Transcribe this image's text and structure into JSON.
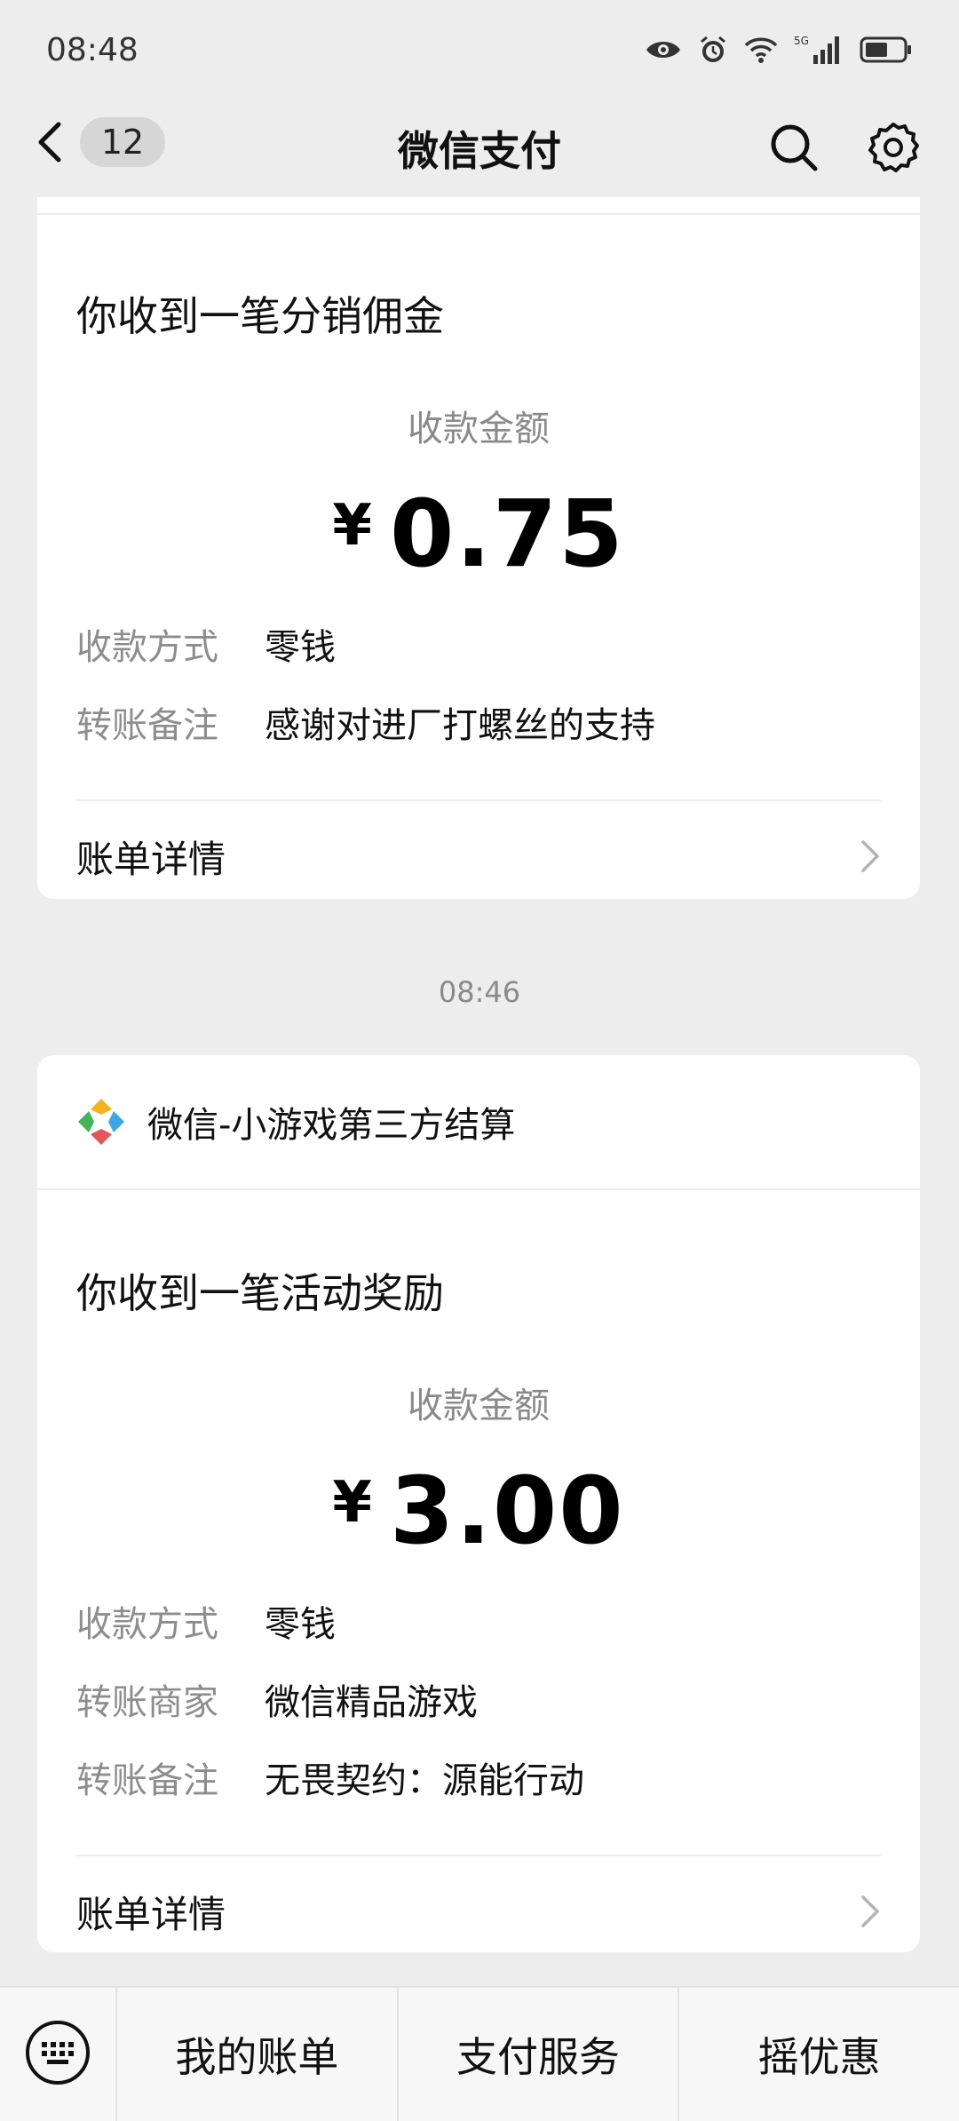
{
  "status_bar": {
    "time": "08:48",
    "icons": [
      "eye-icon",
      "alarm-icon",
      "wifi-icon",
      "signal-5g-icon",
      "battery-icon"
    ],
    "network_label": "5G"
  },
  "nav": {
    "back_badge": "12",
    "title": "微信支付",
    "actions": [
      "search-icon",
      "gear-icon"
    ]
  },
  "cards": [
    {
      "title": "你收到一笔分销佣金",
      "amount_label": "收款金额",
      "currency": "¥",
      "amount": "0.75",
      "rows": [
        {
          "key": "收款方式",
          "value": "零钱"
        },
        {
          "key": "转账备注",
          "value": "感谢对进厂打螺丝的支持"
        }
      ],
      "detail_label": "账单详情"
    },
    {
      "time_separator": "08:46",
      "app_name": "微信-小游戏第三方结算",
      "title": "你收到一笔活动奖励",
      "amount_label": "收款金额",
      "currency": "¥",
      "amount": "3.00",
      "rows": [
        {
          "key": "收款方式",
          "value": "零钱"
        },
        {
          "key": "转账商家",
          "value": "微信精品游戏"
        },
        {
          "key": "转账备注",
          "value": "无畏契约：源能行动"
        }
      ],
      "detail_label": "账单详情"
    }
  ],
  "bottom_bar": {
    "tabs": [
      "我的账单",
      "支付服务",
      "摇优惠"
    ]
  },
  "colors": {
    "background": "#ededed",
    "card": "#ffffff",
    "muted_text": "#8a8a8a",
    "text": "#111111"
  }
}
